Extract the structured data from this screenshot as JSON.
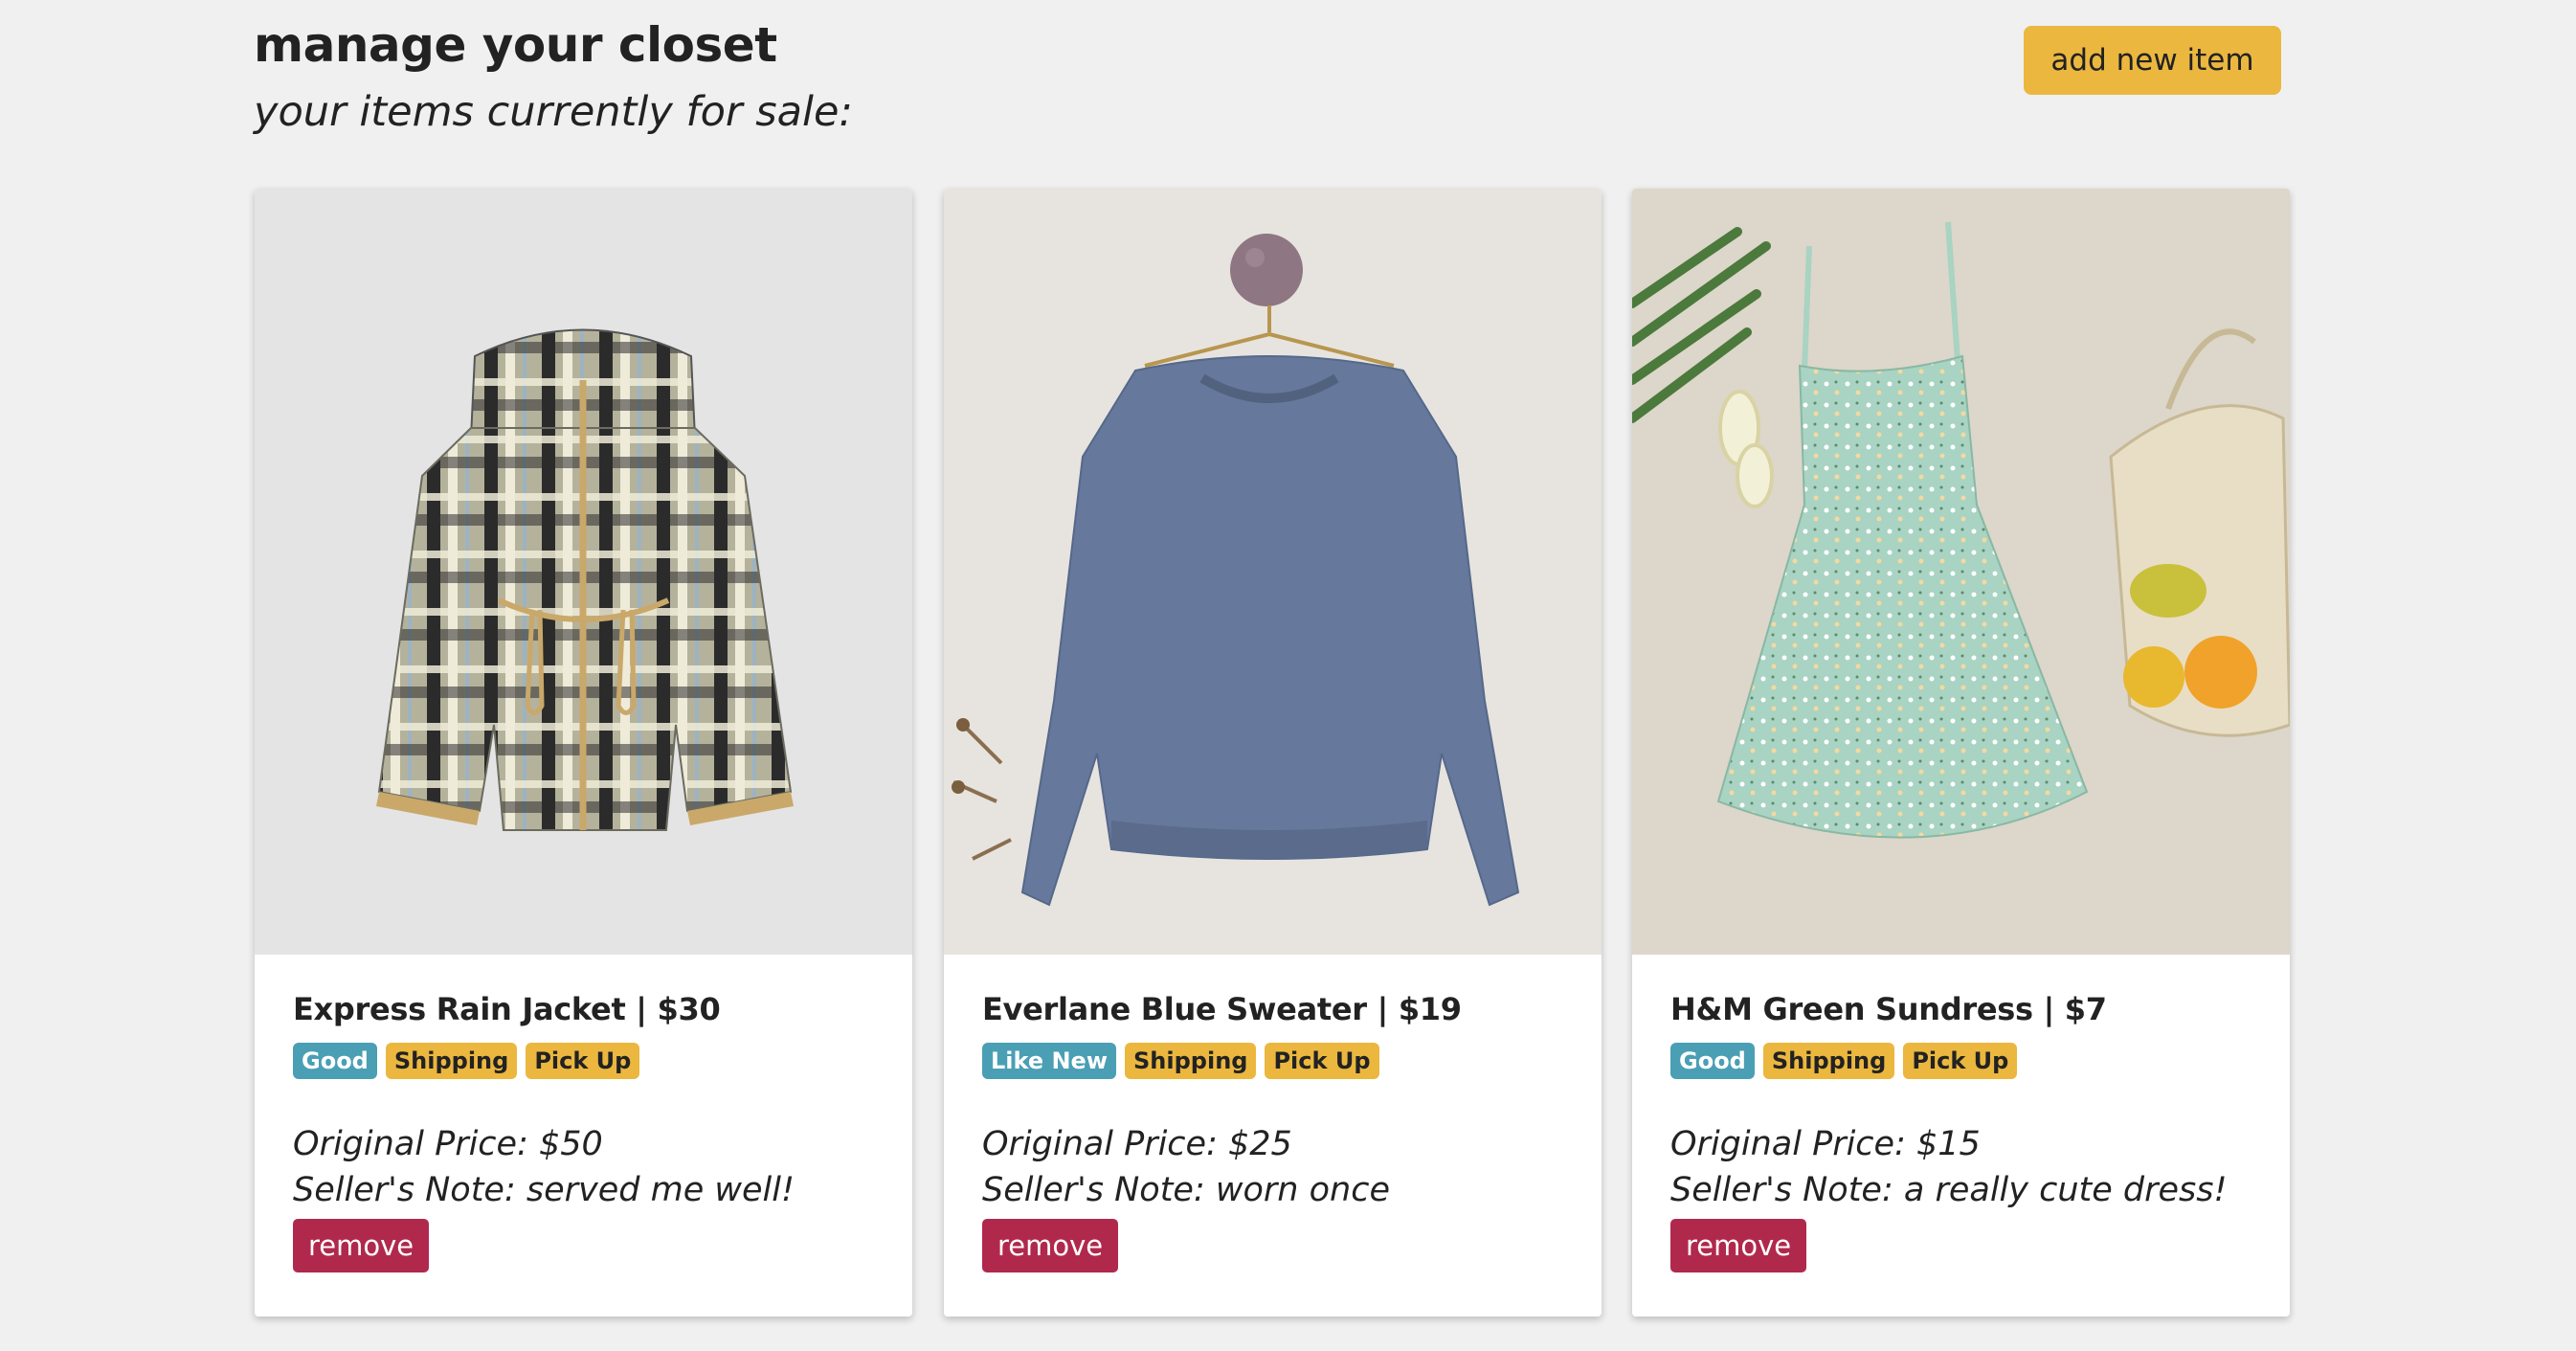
{
  "header": {
    "title": "manage your closet",
    "subtitle": "your items currently for sale:",
    "add_button_label": "add new item"
  },
  "items": [
    {
      "title": "Express Rain Jacket | $30",
      "condition": "Good",
      "options": [
        "Shipping",
        "Pick Up"
      ],
      "original_price": "Original Price: $50",
      "seller_note": "Seller's Note: served me well!",
      "remove_label": "remove"
    },
    {
      "title": "Everlane Blue Sweater | $19",
      "condition": "Like New",
      "options": [
        "Shipping",
        "Pick Up"
      ],
      "original_price": "Original Price: $25",
      "seller_note": "Seller's Note: worn once",
      "remove_label": "remove"
    },
    {
      "title": "H&M Green Sundress | $7",
      "condition": "Good",
      "options": [
        "Shipping",
        "Pick Up"
      ],
      "original_price": "Original Price: $15",
      "seller_note": "Seller's Note: a really cute dress!",
      "remove_label": "remove"
    }
  ],
  "colors": {
    "page_bg": "#f0f0f0",
    "accent_yellow": "#ebb73f",
    "condition_teal": "#4a9fb5",
    "remove_red": "#b0294c"
  }
}
